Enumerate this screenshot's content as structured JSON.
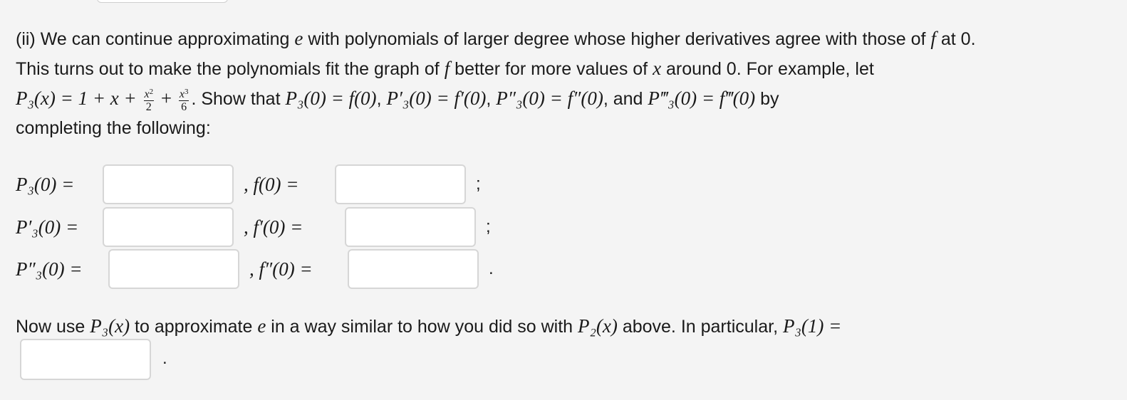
{
  "problem": {
    "line1_a": "(ii) We can continue approximating ",
    "e": "e",
    "line1_b": " with polynomials of larger degree whose higher derivatives agree with those of ",
    "f": "f",
    "line1_c": " at 0.",
    "line2_a": "This turns out to make the polynomials fit the graph of ",
    "line2_b": " better for more values of ",
    "x": "x",
    "line2_c": " around 0. For example, let",
    "line3_poly": "P₃(x) = 1 + x + ",
    "frac1_num": "x",
    "frac1_exp": "2",
    "frac1_den": "2",
    "plus": " + ",
    "frac2_num": "x",
    "frac2_exp": "3",
    "frac2_den": "6",
    "line3_b": ". Show that ",
    "cond1": "P₃(0) = f(0)",
    "cond2": "P′₃(0) = f′(0)",
    "cond3": "P″₃(0) = f″(0)",
    "and": ", and ",
    "cond4": "P‴₃(0) = f‴(0)",
    "by": " by",
    "line4": "completing the following:"
  },
  "rows": [
    {
      "left": "P₃(0) =",
      "right": ", f(0) =",
      "end": ";"
    },
    {
      "left": "P′₃(0) =",
      "right": ", f′(0) =",
      "end": ";"
    },
    {
      "left": "P″₃(0) =",
      "right": ", f″(0) =",
      "end": "."
    }
  ],
  "now": {
    "a": "Now use ",
    "p3x": "P₃(x)",
    "b": " to approximate ",
    "e": "e",
    "c": " in a way similar to how you did so with ",
    "p2x": "P₂(x)",
    "d": " above. In particular, ",
    "p3one": "P₃(1) ="
  },
  "final_end": "."
}
